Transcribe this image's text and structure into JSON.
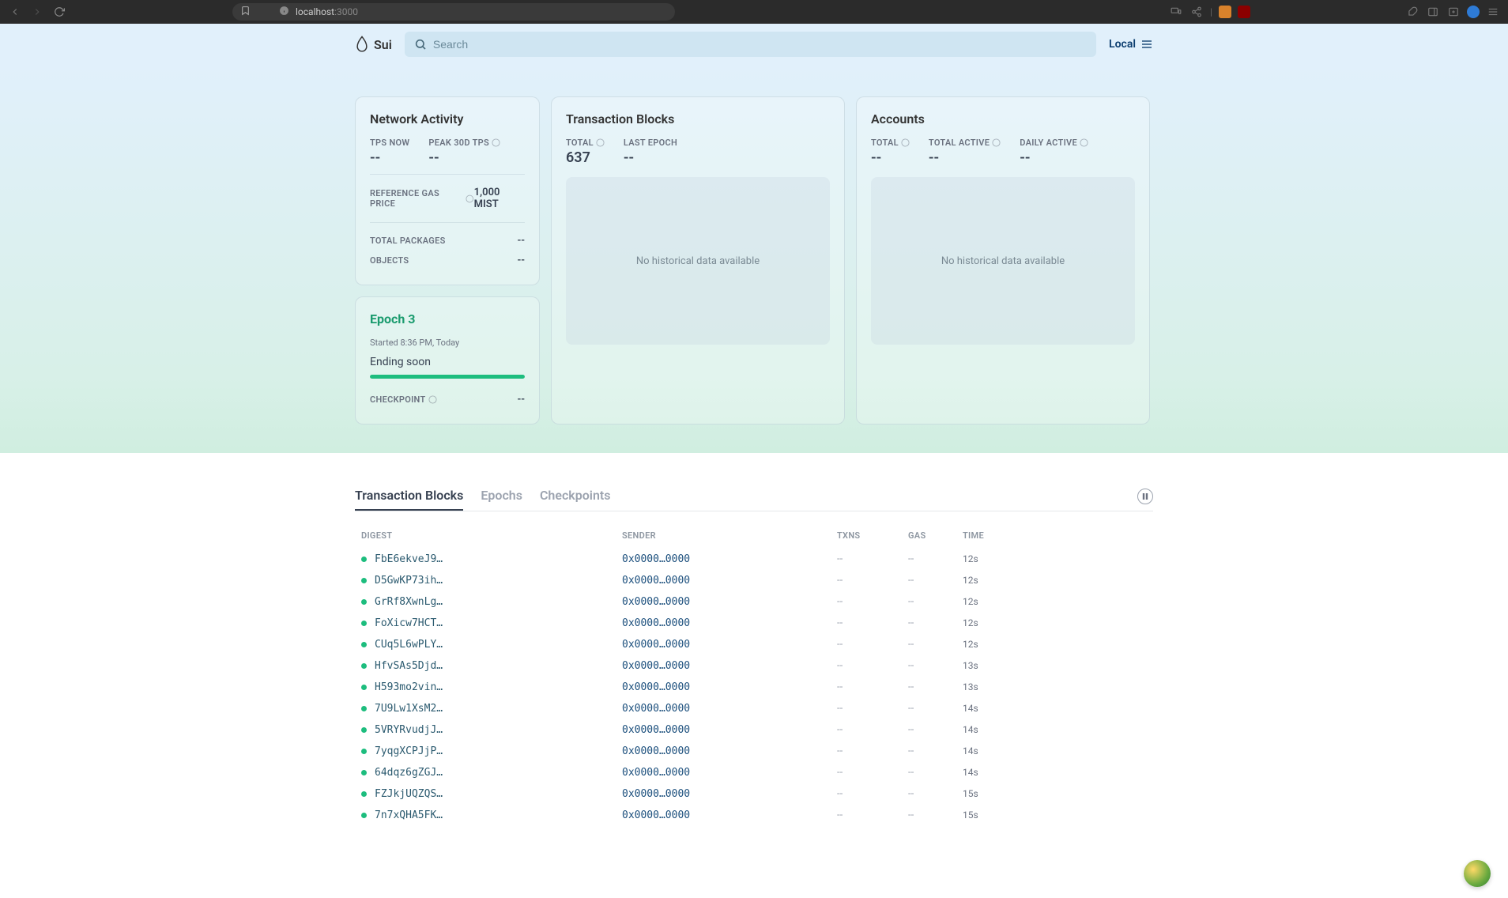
{
  "browser": {
    "host": "localhost",
    "port": ":3000"
  },
  "search": {
    "placeholder": "Search"
  },
  "network": {
    "label": "Local"
  },
  "activity": {
    "title": "Network Activity",
    "tps_now_label": "TPS NOW",
    "tps_now_value": "--",
    "peak_label": "PEAK 30D TPS",
    "peak_value": "--",
    "gas_label": "REFERENCE GAS PRICE",
    "gas_value": "1,000 MIST",
    "packages_label": "TOTAL PACKAGES",
    "packages_value": "--",
    "objects_label": "OBJECTS",
    "objects_value": "--"
  },
  "epoch": {
    "title": "Epoch 3",
    "started": "Started 8:36 PM, Today",
    "ending": "Ending soon",
    "checkpoint_label": "CHECKPOINT",
    "checkpoint_value": "--"
  },
  "txblocks": {
    "title": "Transaction Blocks",
    "total_label": "TOTAL",
    "total_value": "637",
    "last_label": "LAST EPOCH",
    "last_value": "--",
    "empty": "No historical data available"
  },
  "accounts": {
    "title": "Accounts",
    "total_label": "TOTAL",
    "total_value": "--",
    "active_label": "TOTAL ACTIVE",
    "active_value": "--",
    "daily_label": "DAILY ACTIVE",
    "daily_value": "--",
    "empty": "No historical data available"
  },
  "tabs": {
    "tx": "Transaction Blocks",
    "epochs": "Epochs",
    "checkpoints": "Checkpoints"
  },
  "table": {
    "headers": {
      "digest": "DIGEST",
      "sender": "SENDER",
      "txns": "TXNS",
      "gas": "GAS",
      "time": "TIME"
    },
    "rows": [
      {
        "digest": "FbE6ekveJ9…",
        "sender": "0x0000…0000",
        "txns": "--",
        "gas": "--",
        "time": "12s"
      },
      {
        "digest": "D5GwKP73ih…",
        "sender": "0x0000…0000",
        "txns": "--",
        "gas": "--",
        "time": "12s"
      },
      {
        "digest": "GrRf8XwnLg…",
        "sender": "0x0000…0000",
        "txns": "--",
        "gas": "--",
        "time": "12s"
      },
      {
        "digest": "FoXicw7HCT…",
        "sender": "0x0000…0000",
        "txns": "--",
        "gas": "--",
        "time": "12s"
      },
      {
        "digest": "CUq5L6wPLY…",
        "sender": "0x0000…0000",
        "txns": "--",
        "gas": "--",
        "time": "12s"
      },
      {
        "digest": "HfvSAs5Djd…",
        "sender": "0x0000…0000",
        "txns": "--",
        "gas": "--",
        "time": "13s"
      },
      {
        "digest": "H593mo2vin…",
        "sender": "0x0000…0000",
        "txns": "--",
        "gas": "--",
        "time": "13s"
      },
      {
        "digest": "7U9Lw1XsM2…",
        "sender": "0x0000…0000",
        "txns": "--",
        "gas": "--",
        "time": "14s"
      },
      {
        "digest": "5VRYRvudjJ…",
        "sender": "0x0000…0000",
        "txns": "--",
        "gas": "--",
        "time": "14s"
      },
      {
        "digest": "7yqgXCPJjP…",
        "sender": "0x0000…0000",
        "txns": "--",
        "gas": "--",
        "time": "14s"
      },
      {
        "digest": "64dqz6gZGJ…",
        "sender": "0x0000…0000",
        "txns": "--",
        "gas": "--",
        "time": "14s"
      },
      {
        "digest": "FZJkjUQZQS…",
        "sender": "0x0000…0000",
        "txns": "--",
        "gas": "--",
        "time": "15s"
      },
      {
        "digest": "7n7xQHA5FK…",
        "sender": "0x0000…0000",
        "txns": "--",
        "gas": "--",
        "time": "15s"
      }
    ]
  }
}
